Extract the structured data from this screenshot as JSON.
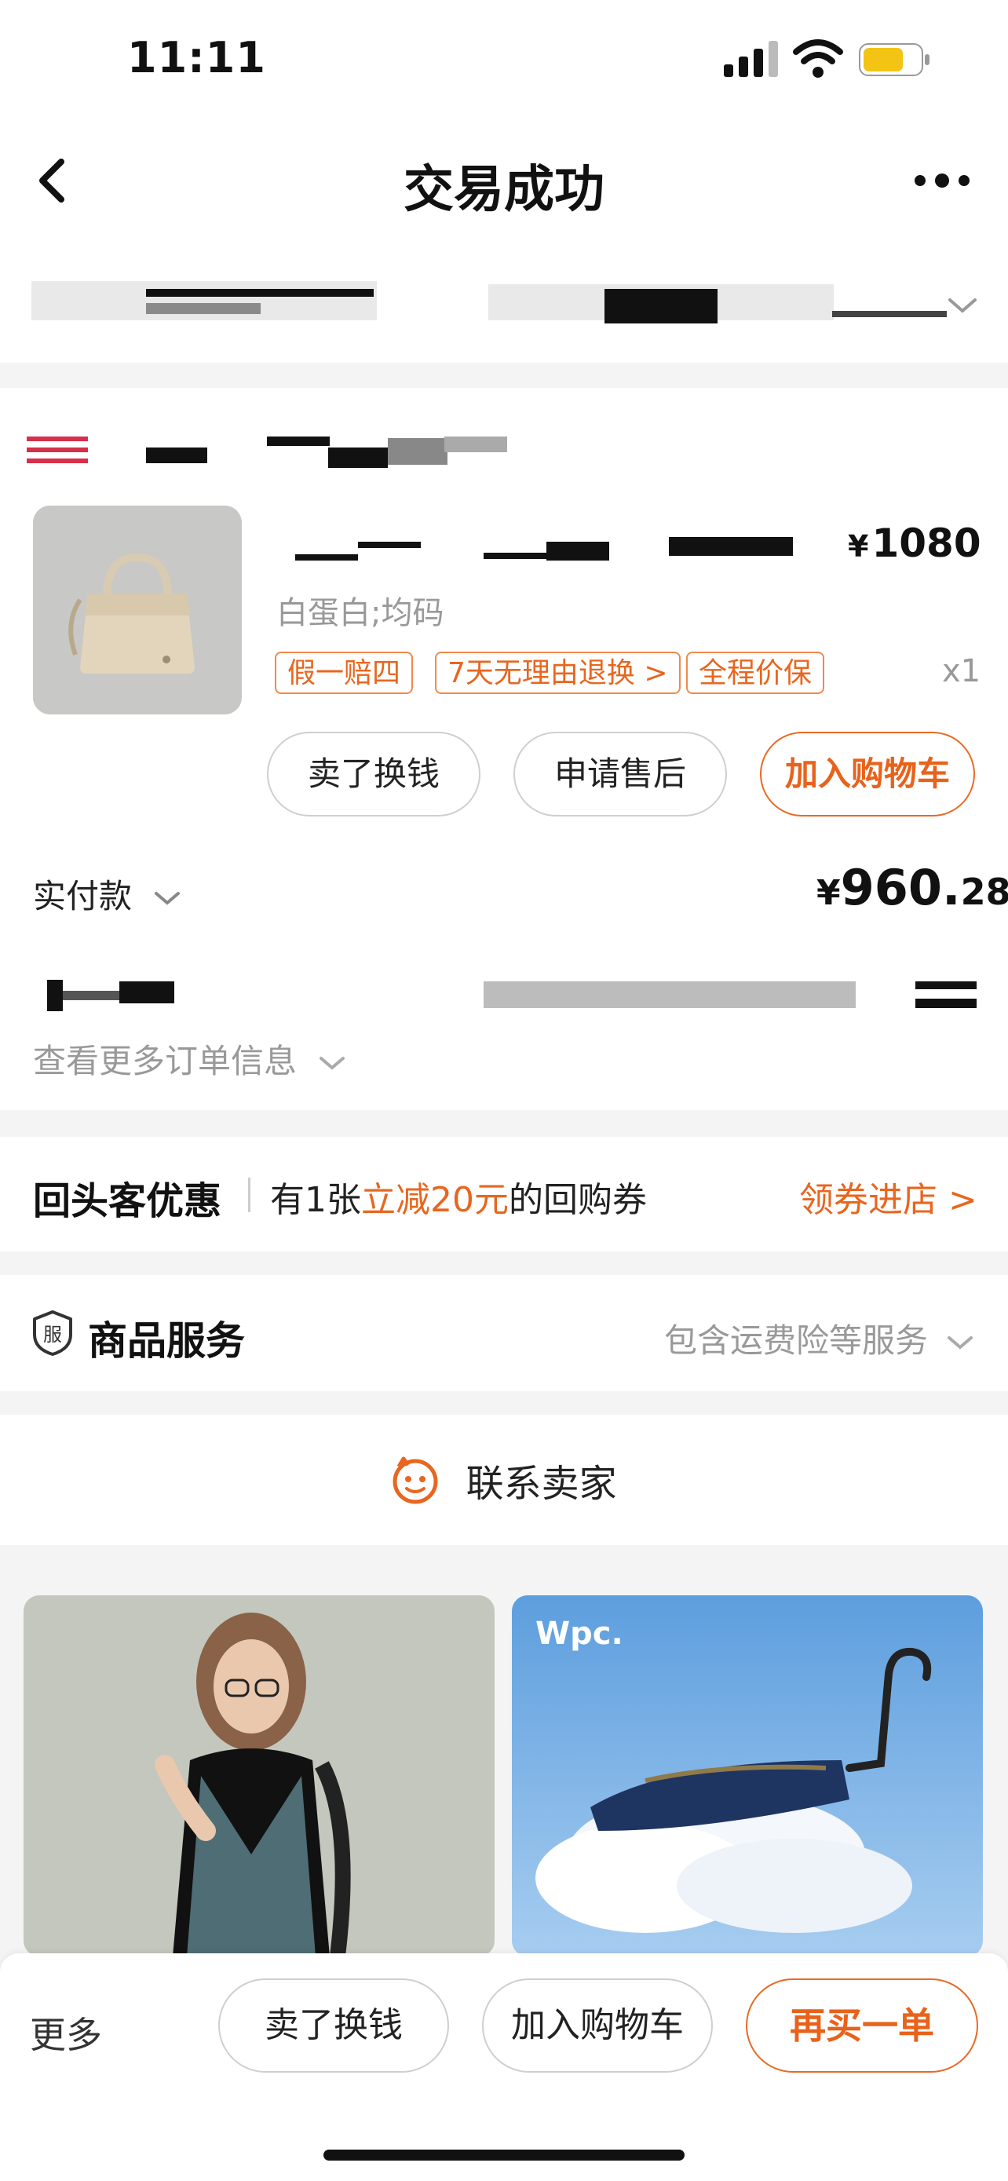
{
  "status_bar": {
    "time": "11:11"
  },
  "nav": {
    "title": "交易成功"
  },
  "product": {
    "price": "1080",
    "currency": "¥",
    "variant": "白蛋白;均码",
    "tags": [
      "假一赔四",
      "7天无理由退换 >",
      "全程价保"
    ],
    "quantity": "x1",
    "actions": {
      "sell": "卖了换钱",
      "after_sale": "申请售后",
      "add_cart": "加入购物车"
    }
  },
  "payment": {
    "label": "实付款",
    "currency": "¥",
    "amount_int": "960.",
    "amount_cents": "28"
  },
  "order_info_link": "查看更多订单信息",
  "coupon": {
    "title": "回头客优惠",
    "text_before": "有1张",
    "text_highlight": "立减20元",
    "text_after": "的回购券",
    "link": "领券进店 >"
  },
  "service": {
    "icon_label": "服",
    "title": "商品服务",
    "desc": "包含运费险等服务"
  },
  "contact_seller": "联系卖家",
  "recommend": {
    "brand_label": "Wpc."
  },
  "bottom_bar": {
    "more": "更多",
    "sell": "卖了换钱",
    "add_cart": "加入购物车",
    "buy_again": "再买一单"
  },
  "colors": {
    "accent": "#e8661f",
    "background": "#f4f4f4"
  }
}
